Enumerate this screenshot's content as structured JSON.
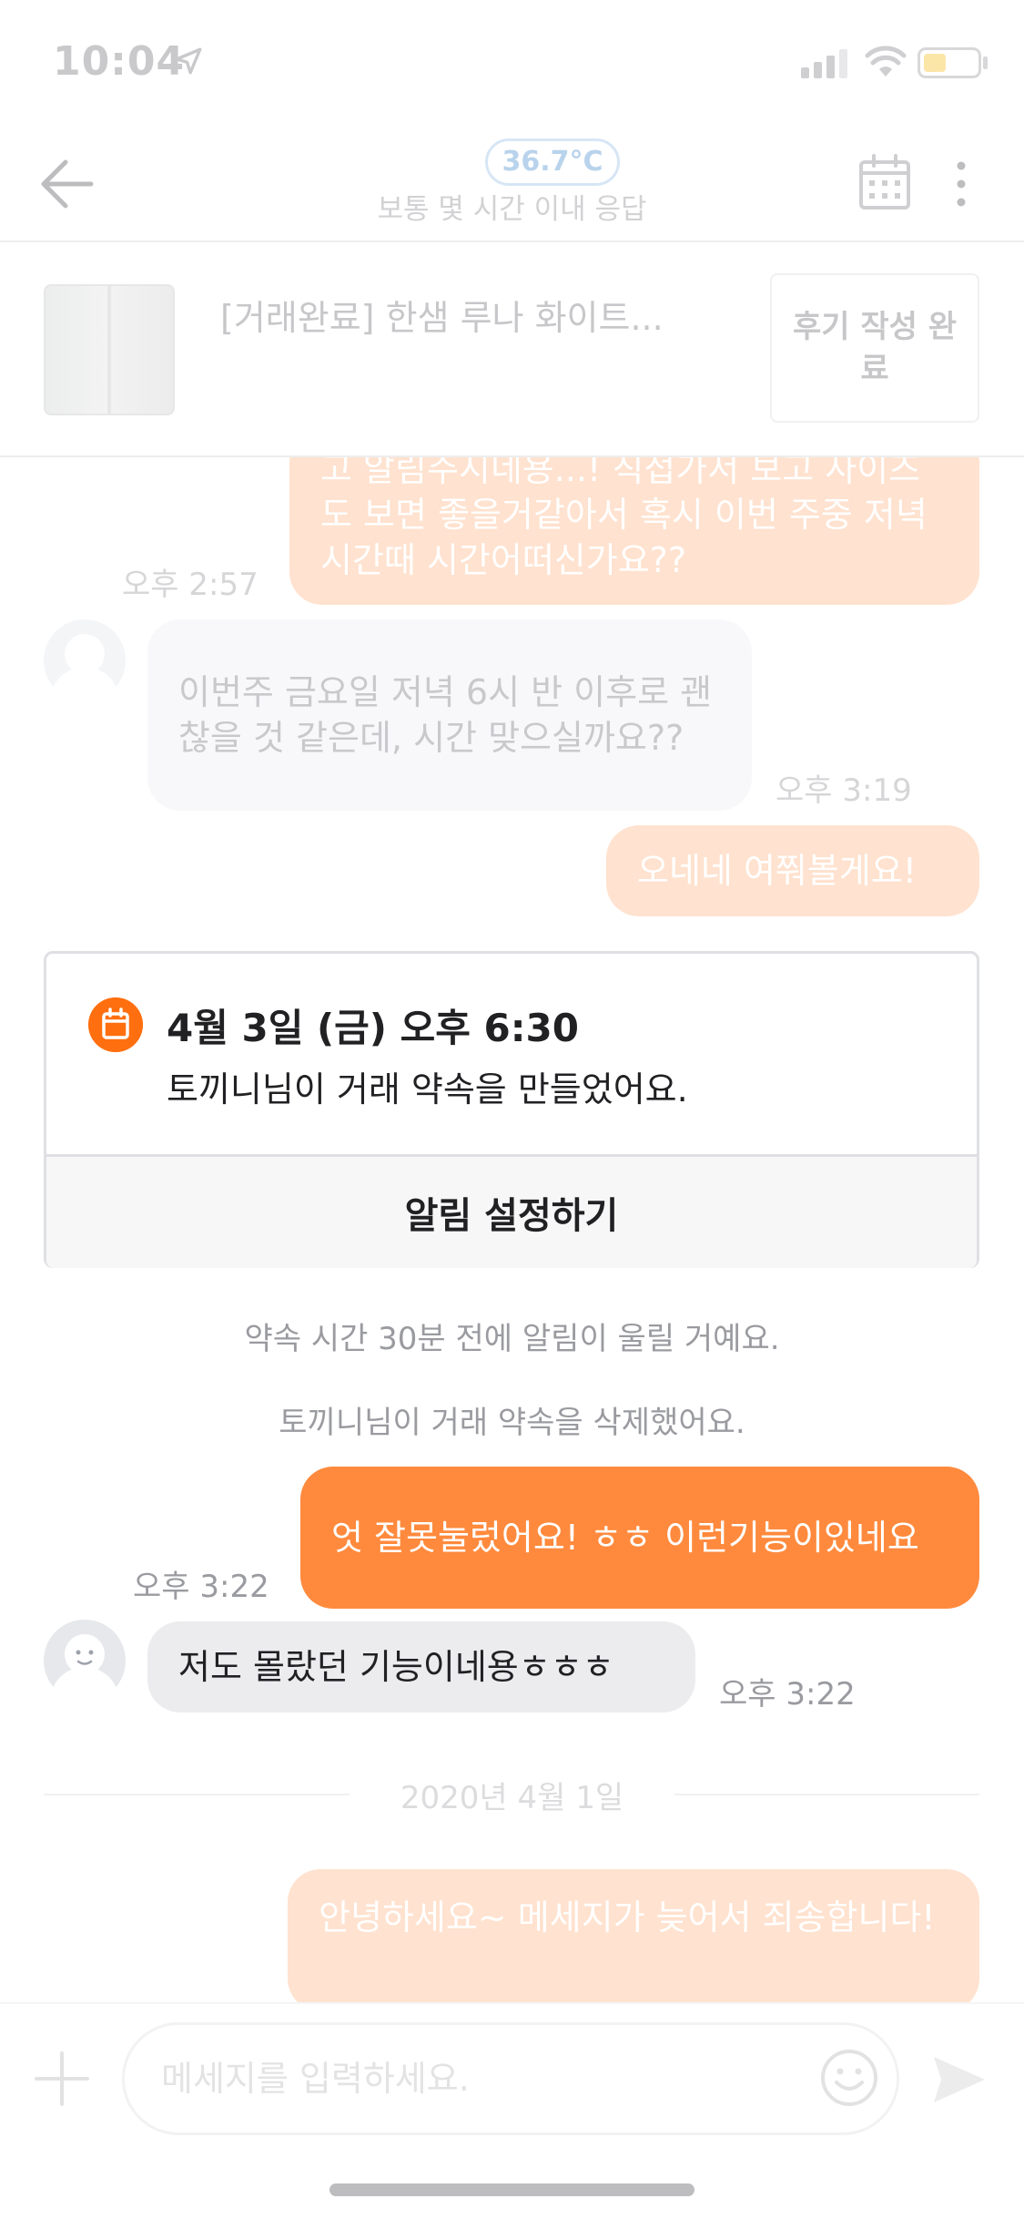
{
  "status_bar": {
    "time": "10:04",
    "icons": [
      "location-arrow-icon",
      "cellular-signal-icon",
      "wifi-icon",
      "battery-icon"
    ]
  },
  "header": {
    "manner_temperature": "36.7°C",
    "response_time": "보통 몇 시간 이내 응답",
    "icons": [
      "back-arrow-icon",
      "calendar-icon",
      "more-vertical-icon"
    ]
  },
  "product": {
    "title": "[거래완료] 한샘 루나 화이트...",
    "review_button": "후기 작성 완료"
  },
  "messages": {
    "m1_text": "고 알림주시네용...! 직접가서 보고 사이즈도 보면 좋을거같아서 혹시 이번 주중 저녁시간때 시간어떠신가요??",
    "m1_time": "오후 2:57",
    "m2_text": "이번주 금요일 저녁 6시 반 이후로 괜찮을 것 같은데, 시간 맞으실까요??",
    "m2_time": "오후 3:19",
    "m3_text": "오네네 여쭤볼게요!",
    "m5_text": "엇 잘못눌렀어요! ㅎㅎ 이런기능이있네요",
    "m5_time": "오후 3:22",
    "m6_text": "저도 몰랐던 기능이네용ㅎㅎㅎ",
    "m6_time": "오후 3:22",
    "m7_text": "안녕하세요~ 메세지가 늦어서 죄송합니다!"
  },
  "appointment": {
    "date": "4월 3일 (금) 오후 6:30",
    "description": "토끼니님이 거래 약속을 만들었어요.",
    "action_label": "알림 설정하기",
    "icon": "calendar-icon"
  },
  "system_messages": {
    "reminder_notice": "약속 시간 30분 전에 알림이 울릴 거예요.",
    "deleted_notice": "토끼니님이 거래 약속을 삭제했어요."
  },
  "date_separator": "2020년 4월 1일",
  "input_bar": {
    "placeholder": "메세지를 입력하세요.",
    "icons": [
      "plus-icon",
      "emoji-icon",
      "send-icon"
    ]
  },
  "colors": {
    "brand_orange": "#ff6f0f",
    "my_bubble": "#ff8a3d",
    "their_bubble": "#ececef"
  }
}
